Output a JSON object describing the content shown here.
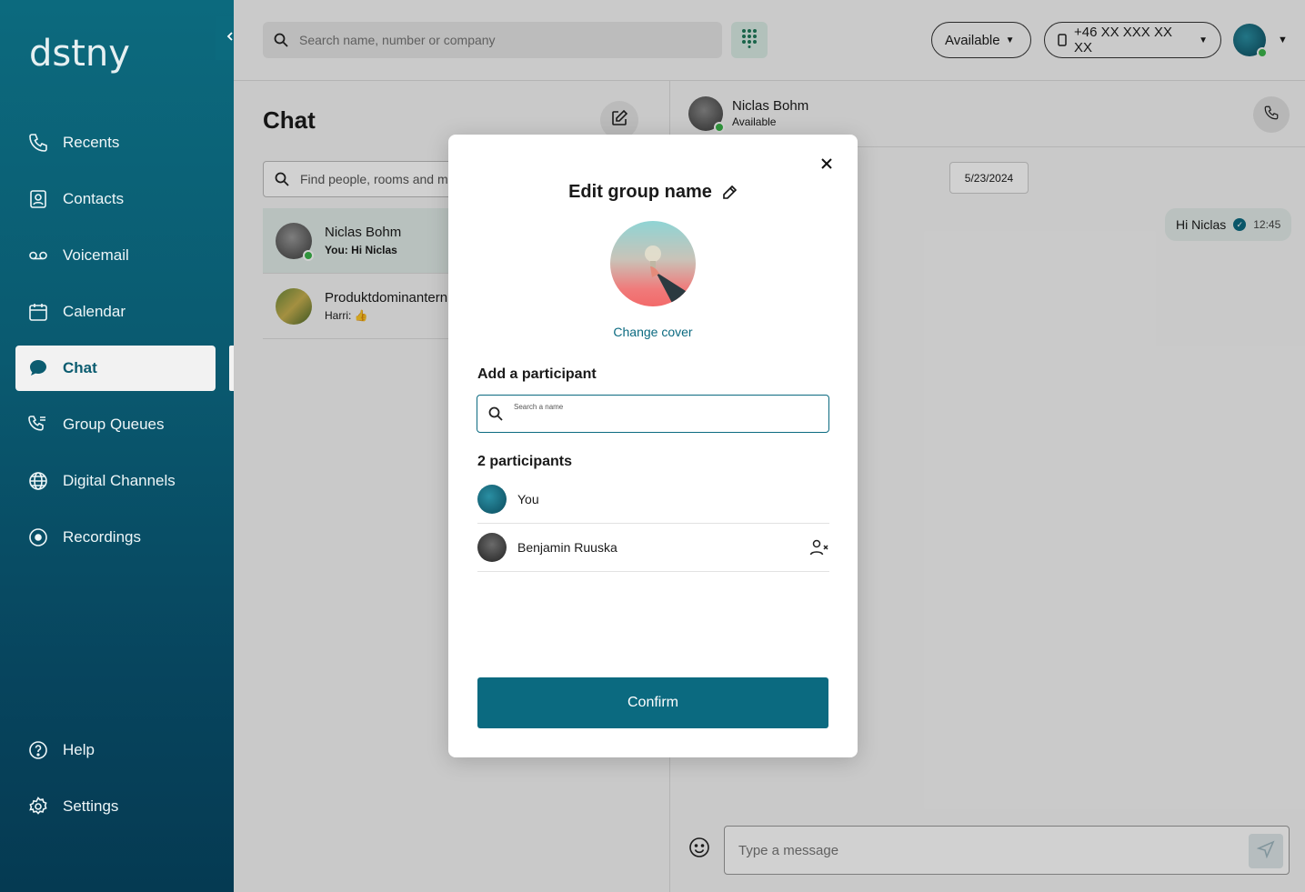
{
  "app": {
    "logo_text": "dstny",
    "accent": "#0b6a80",
    "sidebar_gradient": [
      "#0c6a7e",
      "#053a52"
    ]
  },
  "sidebar": {
    "items": [
      {
        "label": "Recents",
        "icon": "phone-icon"
      },
      {
        "label": "Contacts",
        "icon": "contact-card-icon"
      },
      {
        "label": "Voicemail",
        "icon": "voicemail-icon"
      },
      {
        "label": "Calendar",
        "icon": "calendar-icon"
      },
      {
        "label": "Chat",
        "icon": "chat-bubble-icon",
        "active": true
      },
      {
        "label": "Group Queues",
        "icon": "group-queue-icon"
      },
      {
        "label": "Digital Channels",
        "icon": "globe-icon"
      },
      {
        "label": "Recordings",
        "icon": "record-icon"
      }
    ],
    "bottom_items": [
      {
        "label": "Help",
        "icon": "help-icon"
      },
      {
        "label": "Settings",
        "icon": "gear-icon"
      }
    ]
  },
  "topbar": {
    "search_placeholder": "Search name, number or company",
    "status_label": "Available",
    "phone_label": "+46 XX XXX XX XX"
  },
  "chat_list": {
    "title": "Chat",
    "search_placeholder": "Find people, rooms and m",
    "items": [
      {
        "name": "Niclas Bohm",
        "preview": "You: Hi Niclas",
        "selected": true
      },
      {
        "name": "Produktdominantern",
        "preview": "Harri: 👍"
      }
    ]
  },
  "conversation": {
    "contact_name": "Niclas Bohm",
    "contact_status": "Available",
    "date": "5/23/2024",
    "messages": [
      {
        "text": "Hi Niclas",
        "time": "12:45"
      }
    ],
    "input_placeholder": "Type a message"
  },
  "modal": {
    "title": "Edit group name",
    "change_cover": "Change cover",
    "add_participant_label": "Add a participant",
    "search_placeholder": "Search a name",
    "participants_label": "2 participants",
    "participants": [
      {
        "name": "You"
      },
      {
        "name": "Benjamin Ruuska"
      }
    ],
    "confirm_label": "Confirm"
  }
}
